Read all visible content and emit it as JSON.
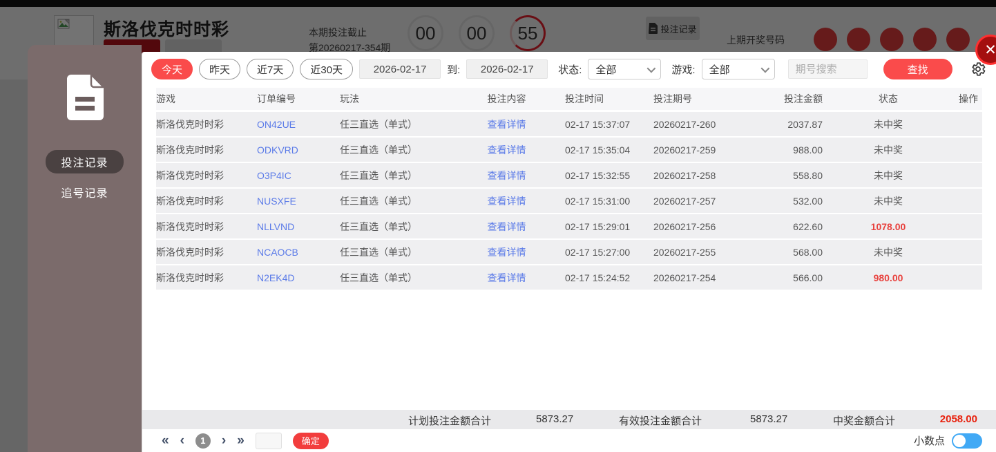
{
  "colors": {
    "accent_red": "#fa4b4b",
    "link_blue": "#5b7be8",
    "win_red": "#e8413d",
    "toggle_blue": "#41a9f5"
  },
  "background": {
    "title": "斯洛伐克时时彩",
    "deadline_line1": "本期投注截止",
    "deadline_line2": "第20260217-354期",
    "countdown": [
      "00",
      "00",
      "55"
    ],
    "bet_record_button": "投注记录",
    "last_draw_label": "上期开奖号码",
    "last_draw_balls": 5
  },
  "sidebar": {
    "items": [
      {
        "label": "投注记录",
        "active": true
      },
      {
        "label": "追号记录",
        "active": false
      }
    ]
  },
  "filters": {
    "quick": [
      "今天",
      "昨天",
      "近7天",
      "近30天"
    ],
    "date_from": "2026-02-17",
    "to_label": "到:",
    "date_to": "2026-02-17",
    "status_label": "状态:",
    "status_value": "全部",
    "game_label": "游戏:",
    "game_value": "全部",
    "search_placeholder": "期号搜索",
    "find_button": "查找"
  },
  "table": {
    "headers": [
      "游戏",
      "订单编号",
      "玩法",
      "投注内容",
      "投注时间",
      "投注期号",
      "投注金额",
      "状态",
      "操作"
    ],
    "rows": [
      {
        "game": "斯洛伐克时时彩",
        "order": "ON42UE",
        "play": "任三直选（单式）",
        "content": "查看详情",
        "time": "02-17 15:37:07",
        "period": "20260217-260",
        "amount": "2037.87",
        "status": "未中奖",
        "win": false
      },
      {
        "game": "斯洛伐克时时彩",
        "order": "ODKVRD",
        "play": "任三直选（单式）",
        "content": "查看详情",
        "time": "02-17 15:35:04",
        "period": "20260217-259",
        "amount": "988.00",
        "status": "未中奖",
        "win": false
      },
      {
        "game": "斯洛伐克时时彩",
        "order": "O3P4IC",
        "play": "任三直选（单式）",
        "content": "查看详情",
        "time": "02-17 15:32:55",
        "period": "20260217-258",
        "amount": "558.80",
        "status": "未中奖",
        "win": false
      },
      {
        "game": "斯洛伐克时时彩",
        "order": "NUSXFE",
        "play": "任三直选（单式）",
        "content": "查看详情",
        "time": "02-17 15:31:00",
        "period": "20260217-257",
        "amount": "532.00",
        "status": "未中奖",
        "win": false
      },
      {
        "game": "斯洛伐克时时彩",
        "order": "NLLVND",
        "play": "任三直选（单式）",
        "content": "查看详情",
        "time": "02-17 15:29:01",
        "period": "20260217-256",
        "amount": "622.60",
        "status": "1078.00",
        "win": true
      },
      {
        "game": "斯洛伐克时时彩",
        "order": "NCAOCB",
        "play": "任三直选（单式）",
        "content": "查看详情",
        "time": "02-17 15:27:00",
        "period": "20260217-255",
        "amount": "568.00",
        "status": "未中奖",
        "win": false
      },
      {
        "game": "斯洛伐克时时彩",
        "order": "N2EK4D",
        "play": "任三直选（单式）",
        "content": "查看详情",
        "time": "02-17 15:24:52",
        "period": "20260217-254",
        "amount": "566.00",
        "status": "980.00",
        "win": true
      }
    ]
  },
  "summary": {
    "plan_label": "计划投注金额合计",
    "plan_value": "5873.27",
    "valid_label": "有效投注金额合计",
    "valid_value": "5873.27",
    "win_label": "中奖金额合计",
    "win_value": "2058.00"
  },
  "pagination": {
    "first": "«",
    "prev": "‹",
    "current": "1",
    "next": "›",
    "last": "»",
    "page_input_value": "",
    "confirm_label": "确定"
  },
  "footer": {
    "decimal_label": "小数点",
    "decimal_on": true
  },
  "close_glyph": "✕"
}
